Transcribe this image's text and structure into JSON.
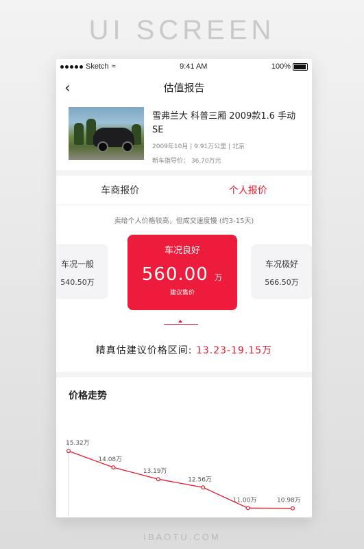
{
  "banner": "UI SCREEN",
  "footer": "IBAOTU.COM",
  "status": {
    "carrier": "Sketch",
    "time": "9:41 AM",
    "battery": "100%"
  },
  "nav": {
    "title": "估值报告",
    "back_icon": "chevron-left-icon"
  },
  "car": {
    "title": "雪弗兰大 科普三厢 2009款1.6 手动SE",
    "meta": "2009年10月 | 9.91万公里 | 北京",
    "new_price": "新车指导价： 36.70万元"
  },
  "tabs": [
    {
      "label": "车商报价",
      "active": false
    },
    {
      "label": "个人报价",
      "active": true
    }
  ],
  "hint": "卖给个人价格较高，但成交速度慢 (约3-15天)",
  "cards": {
    "left": {
      "label": "车况一般",
      "value": "540.50万"
    },
    "main": {
      "label": "车况良好",
      "value": "560.00",
      "unit": "万",
      "sub": "建议售价"
    },
    "right": {
      "label": "车况极好",
      "value": "566.50万"
    }
  },
  "range": {
    "label": "精真估建议价格区间:",
    "value": "13.23-19.15万"
  },
  "trend": {
    "title": "价格走势"
  },
  "colors": {
    "accent": "#e8192c",
    "card": "#ee1c3c"
  },
  "chart_data": {
    "type": "line",
    "title": "价格走势",
    "x": [
      1,
      2,
      3,
      4,
      5,
      6
    ],
    "labels": [
      "15.32万",
      "14.08万",
      "13.19万",
      "12.56万",
      "11.00万",
      "10.98万"
    ],
    "values": [
      15.32,
      14.08,
      13.19,
      12.56,
      11.0,
      10.98
    ],
    "ylim": [
      10.6,
      15.8
    ],
    "grid": false
  }
}
